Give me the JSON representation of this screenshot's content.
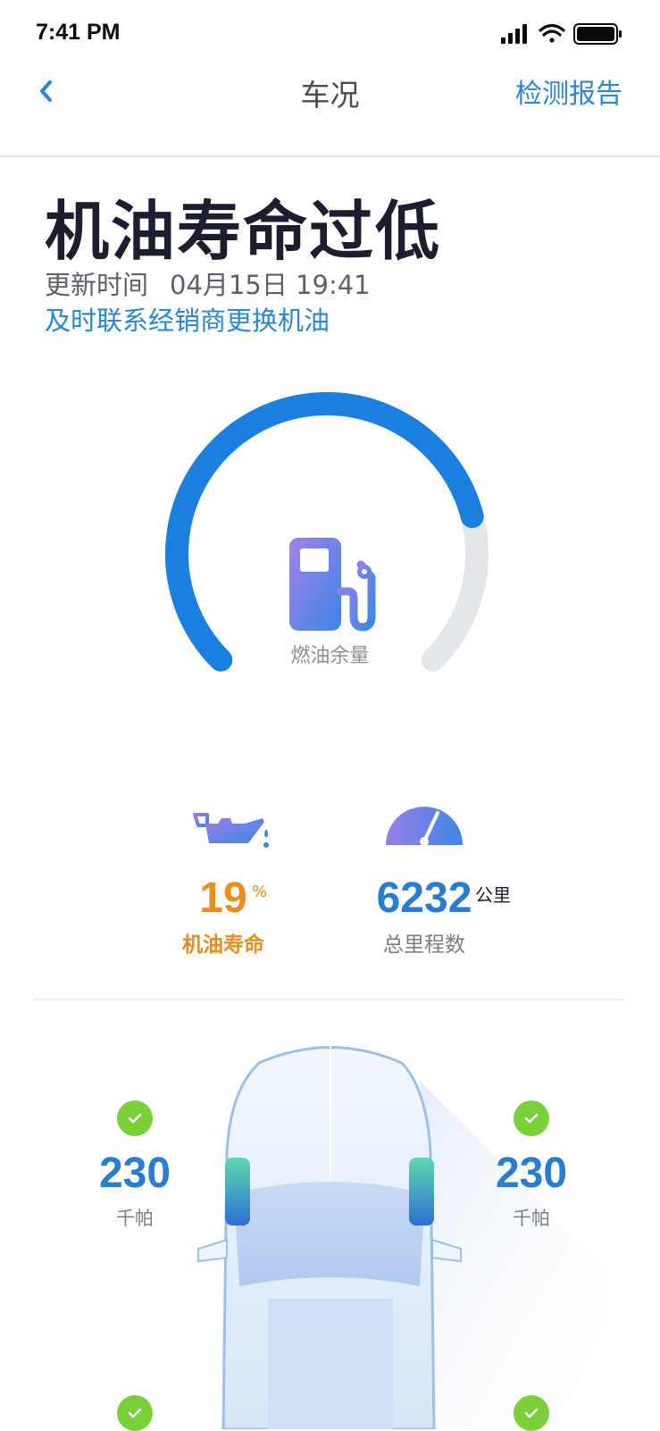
{
  "status_bar": {
    "time": "7:41 PM",
    "icons": [
      "signal-icon",
      "wifi-icon",
      "battery-icon"
    ]
  },
  "nav": {
    "back_icon": "chevron-left-icon",
    "title": "车况",
    "action_label": "检测报告"
  },
  "headline": {
    "title": "机油寿命过低",
    "update_label": "更新时间",
    "update_time": "04月15日 19:41",
    "advice": "及时联系经销商更换机油"
  },
  "fuel_gauge": {
    "label": "燃油余量",
    "icon": "fuel-pump-icon",
    "level": 0.78
  },
  "stats": {
    "oil_life": {
      "icon": "oil-can-icon",
      "value": "19",
      "unit": "%",
      "label": "机油寿命"
    },
    "mileage": {
      "icon": "speedometer-icon",
      "value": "6232",
      "unit": "公里",
      "label": "总里程数"
    }
  },
  "tires": [
    {
      "name": "front-left",
      "value": "230",
      "unit": "千帕",
      "status": "ok"
    },
    {
      "name": "front-right",
      "value": "230",
      "unit": "千帕",
      "status": "ok"
    },
    {
      "name": "rear-left",
      "status": "ok"
    },
    {
      "name": "rear-right",
      "status": "ok"
    }
  ],
  "colors": {
    "accent": "#2a86d6",
    "gauge_fill": "#1a7fe0",
    "gauge_track": "#e3e6ea",
    "warning": "#e88d1e",
    "ok": "#7ad03a",
    "title_text": "#1c1d2e"
  }
}
